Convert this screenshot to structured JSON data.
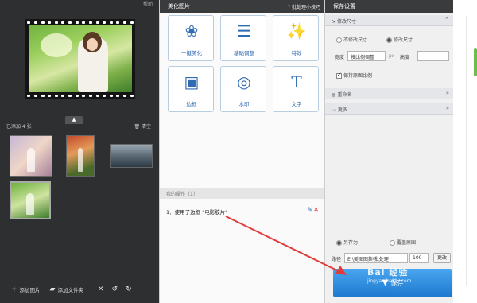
{
  "left": {
    "help": "帮助",
    "added_label": "已添加 4 张",
    "clear": "清空",
    "bottom": {
      "add_image": "添加图片",
      "add_folder": "添加文件夹"
    }
  },
  "middle": {
    "title": "美化图片",
    "tips": "批处理小技巧",
    "tools": [
      "一键美化",
      "基础调整",
      "特效",
      "边框",
      "水印",
      "文字"
    ],
    "history_title": "我的操作（1）",
    "history_item": "1．使用了边框 \"电影胶片\""
  },
  "right": {
    "title": "保存设置",
    "sec_size": "修改尺寸",
    "radio_keep": "不修改尺寸",
    "radio_change": "修改尺寸",
    "width_label": "宽度",
    "width_value": "按比例调整",
    "unit": "px",
    "height_label": "高度",
    "keep_ratio": "保持原图比例",
    "sec_rename": "重命名",
    "sec_more": "更多",
    "save_as": "另存为",
    "overwrite": "覆盖原图",
    "path_label": "路径",
    "path_value": "E:\\美图图集\\批处理",
    "path_suffix": "100",
    "change_btn": "更改",
    "save": "保存"
  },
  "watermark": {
    "main": "Bai 经验",
    "sub": "jingyan.baidu.com"
  }
}
